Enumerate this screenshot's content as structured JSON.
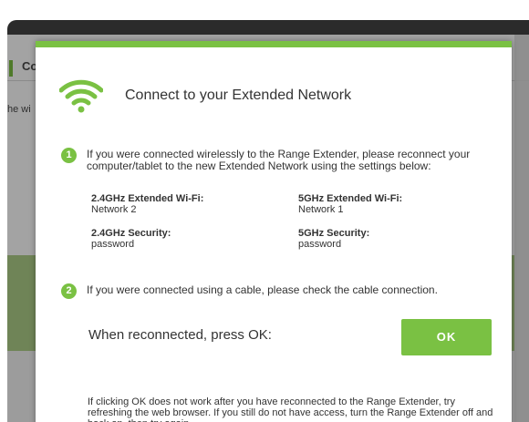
{
  "background": {
    "heading": "Co",
    "text": "he wi"
  },
  "modal": {
    "title": "Connect to your Extended Network",
    "icon": "wifi-icon",
    "accent": "#7ac143",
    "step1": {
      "number": "1",
      "text": "If you were connected wirelessly to the Range Extender, please reconnect your computer/tablet to the new Extended Network using the settings below:"
    },
    "credentials": {
      "wifi24_label": "2.4GHz Extended Wi-Fi:",
      "wifi24_value": "Network 2",
      "wifi5_label": "5GHz Extended Wi-Fi:",
      "wifi5_value": "Network 1",
      "sec24_label": "2.4GHz Security:",
      "sec24_value": "password",
      "sec5_label": "5GHz Security:",
      "sec5_value": "password"
    },
    "step2": {
      "number": "2",
      "text": "If you were connected using a cable, please check the cable connection."
    },
    "reconnect_text": "When reconnected, press OK:",
    "ok_label": "OK",
    "footer": "If clicking OK does not work after you have reconnected to the Range Extender, try refreshing the web browser. If you still do not have access, turn the Range Extender off and back on, then try again."
  }
}
